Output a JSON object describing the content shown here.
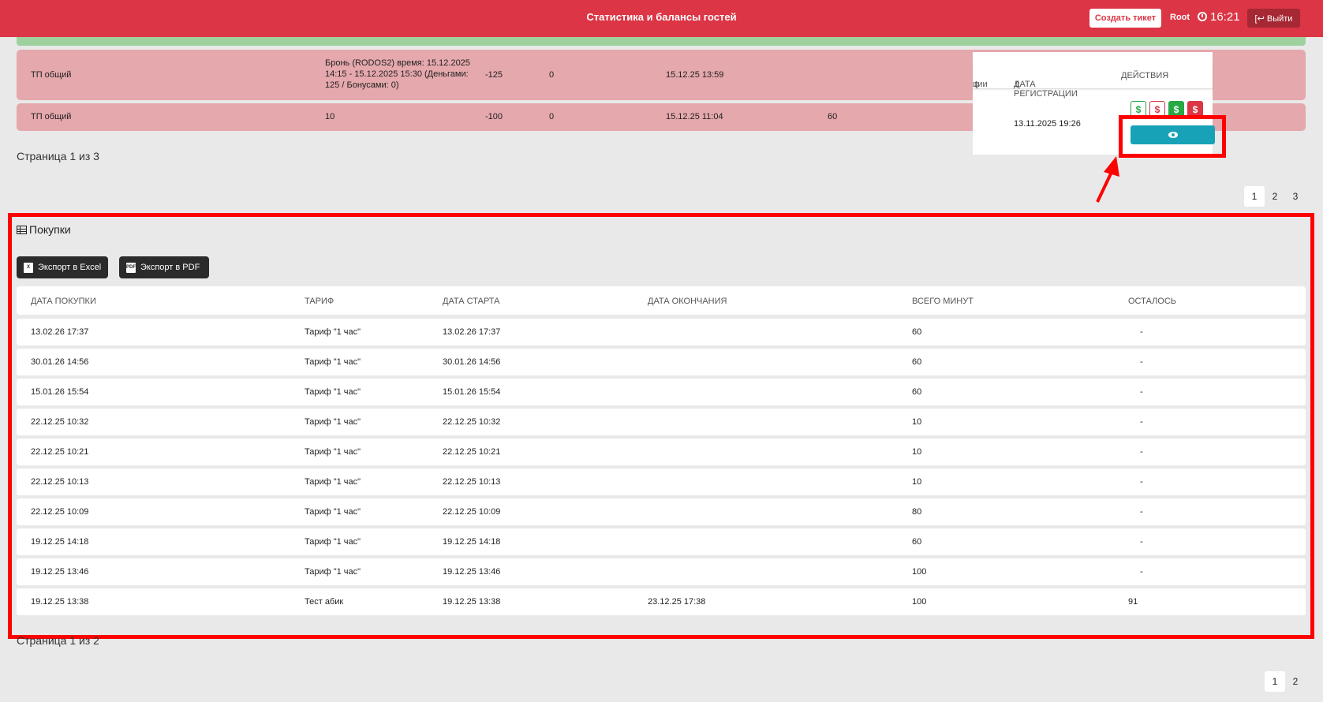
{
  "header": {
    "title": "Статистика и балансы гостей",
    "create_ticket": "Создать тикет",
    "user": "Root",
    "time": "16:21",
    "logout": "Выйти"
  },
  "balance_rows": [
    {
      "type": "ТП общий",
      "description": "Бронь (RODOS2) время: 15.12.2025 14:15 - 15.12.2025 15:30 (Деньгами: 125 / Бонусами: 0)",
      "amount": "-125",
      "bonus": "0",
      "date": "15.12.25 13:59",
      "minutes": ""
    },
    {
      "type": "ТП общий",
      "description": "10",
      "amount": "-100",
      "bonus": "0",
      "date": "15.12.25 11:04",
      "minutes": "60"
    }
  ],
  "balance_page_text": "Страница 1 из 3",
  "balance_pages": [
    "1",
    "2",
    "3"
  ],
  "inset": {
    "col_partial": "ции",
    "col_reg_date": "ДАТА РЕГИСТРАЦИИ",
    "col_actions": "ДЕЙСТВИЯ",
    "reg_date": "13.11.2025 19:26",
    "dollar_symbol": "$"
  },
  "purchases": {
    "title": "Покупки",
    "export_excel": "Экспорт в Excel",
    "export_pdf": "Экспорт в PDF",
    "columns": [
      "ДАТА ПОКУПКИ",
      "ТАРИФ",
      "ДАТА СТАРТА",
      "ДАТА ОКОНЧАНИЯ",
      "ВСЕГО МИНУТ",
      "ОСТАЛОСЬ"
    ],
    "rows": [
      [
        "13.02.26 17:37",
        "Тариф \"1 час\"",
        "13.02.26 17:37",
        "",
        "60",
        "-"
      ],
      [
        "30.01.26 14:56",
        "Тариф \"1 час\"",
        "30.01.26 14:56",
        "",
        "60",
        "-"
      ],
      [
        "15.01.26 15:54",
        "Тариф \"1 час\"",
        "15.01.26 15:54",
        "",
        "60",
        "-"
      ],
      [
        "22.12.25 10:32",
        "Тариф \"1 час\"",
        "22.12.25 10:32",
        "",
        "10",
        "-"
      ],
      [
        "22.12.25 10:21",
        "Тариф \"1 час\"",
        "22.12.25 10:21",
        "",
        "10",
        "-"
      ],
      [
        "22.12.25 10:13",
        "Тариф \"1 час\"",
        "22.12.25 10:13",
        "",
        "10",
        "-"
      ],
      [
        "22.12.25 10:09",
        "Тариф \"1 час\"",
        "22.12.25 10:09",
        "",
        "80",
        "-"
      ],
      [
        "19.12.25 14:18",
        "Тариф \"1 час\"",
        "19.12.25 14:18",
        "",
        "60",
        "-"
      ],
      [
        "19.12.25 13:46",
        "Тариф \"1 час\"",
        "19.12.25 13:46",
        "",
        "100",
        "-"
      ],
      [
        "19.12.25 13:38",
        "Тест абик",
        "19.12.25 13:38",
        "23.12.25 17:38",
        "100",
        "91"
      ]
    ],
    "page_text": "Страница 1 из 2",
    "pages": [
      "1",
      "2"
    ]
  },
  "colors": {
    "header": "#dc3545",
    "row_negative": "#e5a8ac",
    "row_positive": "#9fd19f",
    "annotation": "#ff0000",
    "view_button": "#17a2b8"
  }
}
